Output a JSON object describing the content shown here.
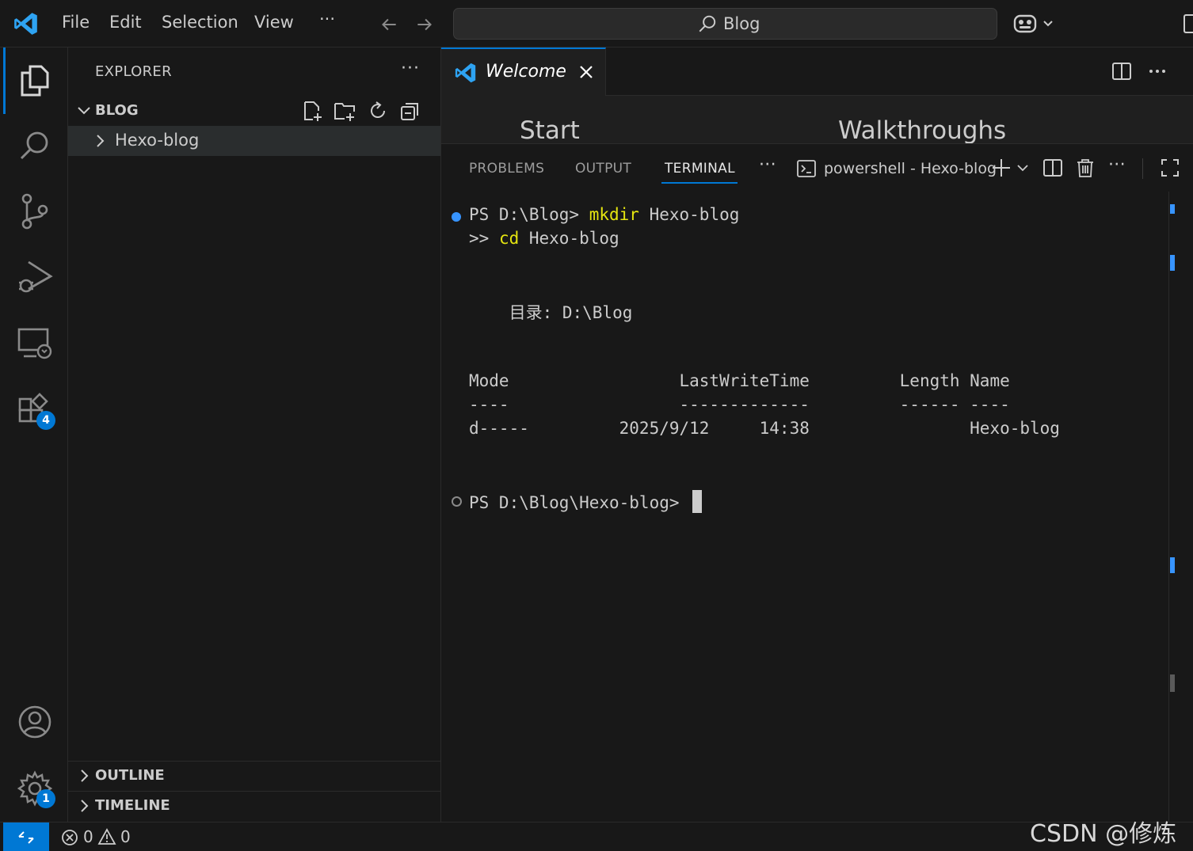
{
  "titlebar": {
    "menu": [
      "File",
      "Edit",
      "Selection",
      "View"
    ],
    "more": "···",
    "search_text": "Blog"
  },
  "activitybar": {
    "extensions_badge": "4",
    "settings_badge": "1"
  },
  "sidebar": {
    "title": "EXPLORER",
    "more": "···",
    "folder_name": "BLOG",
    "items": [
      {
        "label": "Hexo-blog"
      }
    ],
    "outline": "OUTLINE",
    "timeline": "TIMELINE"
  },
  "editor": {
    "tab_label": "Welcome",
    "welcome_start": "Start",
    "welcome_walkthroughs": "Walkthroughs"
  },
  "panel": {
    "tabs": [
      "PROBLEMS",
      "OUTPUT",
      "TERMINAL"
    ],
    "more": "···",
    "terminal_name": "powershell - Hexo-blog",
    "more2": "···"
  },
  "terminal": {
    "line1_prompt": "PS D:\\Blog> ",
    "line1_cmd": "mkdir",
    "line1_arg": " Hexo-blog",
    "line2_prompt": ">> ",
    "line2_cmd": "cd",
    "line2_arg": " Hexo-blog",
    "dir_line": "    目录: D:\\Blog",
    "header": "Mode                 LastWriteTime         Length Name",
    "underline": "----                 -------------         ------ ----",
    "row": "d-----         2025/9/12     14:38                Hexo-blog",
    "final_prompt": "PS D:\\Blog\\Hexo-blog> "
  },
  "statusbar": {
    "errors": "0",
    "warnings": "0"
  },
  "watermark": "CSDN @修炼室",
  "colors": {
    "accent": "#0078d4",
    "terminal_yellow": "#e5e510",
    "background": "#1f1f1f"
  }
}
